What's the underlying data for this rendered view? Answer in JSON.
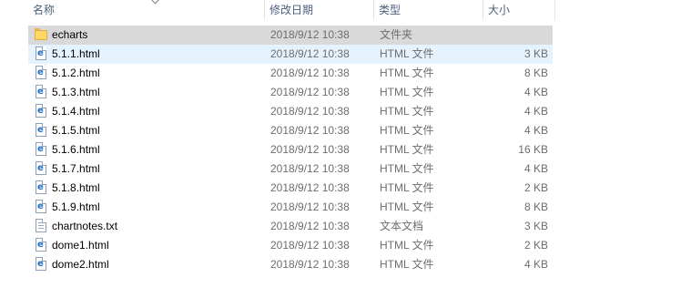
{
  "columns": {
    "name": "名称",
    "date": "修改日期",
    "type": "类型",
    "size": "大小"
  },
  "files": [
    {
      "name": "echarts",
      "date": "2018/9/12 10:38",
      "type": "文件夹",
      "size": "",
      "icon": "folder-icon",
      "state": "selected"
    },
    {
      "name": "5.1.1.html",
      "date": "2018/9/12 10:38",
      "type": "HTML 文件",
      "size": "3 KB",
      "icon": "html-file-icon",
      "state": "hover"
    },
    {
      "name": "5.1.2.html",
      "date": "2018/9/12 10:38",
      "type": "HTML 文件",
      "size": "8 KB",
      "icon": "html-file-icon",
      "state": ""
    },
    {
      "name": "5.1.3.html",
      "date": "2018/9/12 10:38",
      "type": "HTML 文件",
      "size": "4 KB",
      "icon": "html-file-icon",
      "state": ""
    },
    {
      "name": "5.1.4.html",
      "date": "2018/9/12 10:38",
      "type": "HTML 文件",
      "size": "4 KB",
      "icon": "html-file-icon",
      "state": ""
    },
    {
      "name": "5.1.5.html",
      "date": "2018/9/12 10:38",
      "type": "HTML 文件",
      "size": "4 KB",
      "icon": "html-file-icon",
      "state": ""
    },
    {
      "name": "5.1.6.html",
      "date": "2018/9/12 10:38",
      "type": "HTML 文件",
      "size": "16 KB",
      "icon": "html-file-icon",
      "state": ""
    },
    {
      "name": "5.1.7.html",
      "date": "2018/9/12 10:38",
      "type": "HTML 文件",
      "size": "4 KB",
      "icon": "html-file-icon",
      "state": ""
    },
    {
      "name": "5.1.8.html",
      "date": "2018/9/12 10:38",
      "type": "HTML 文件",
      "size": "2 KB",
      "icon": "html-file-icon",
      "state": ""
    },
    {
      "name": "5.1.9.html",
      "date": "2018/9/12 10:38",
      "type": "HTML 文件",
      "size": "8 KB",
      "icon": "html-file-icon",
      "state": ""
    },
    {
      "name": "chartnotes.txt",
      "date": "2018/9/12 10:38",
      "type": "文本文档",
      "size": "3 KB",
      "icon": "text-file-icon",
      "state": ""
    },
    {
      "name": "dome1.html",
      "date": "2018/9/12 10:38",
      "type": "HTML 文件",
      "size": "2 KB",
      "icon": "html-file-icon",
      "state": ""
    },
    {
      "name": "dome2.html",
      "date": "2018/9/12 10:38",
      "type": "HTML 文件",
      "size": "4 KB",
      "icon": "html-file-icon",
      "state": ""
    }
  ],
  "colors": {
    "header_text": "#4c607a",
    "selected_row": "#d9d9d9",
    "hover_row": "#e5f3ff",
    "secondary_text": "#6d6d6d"
  }
}
